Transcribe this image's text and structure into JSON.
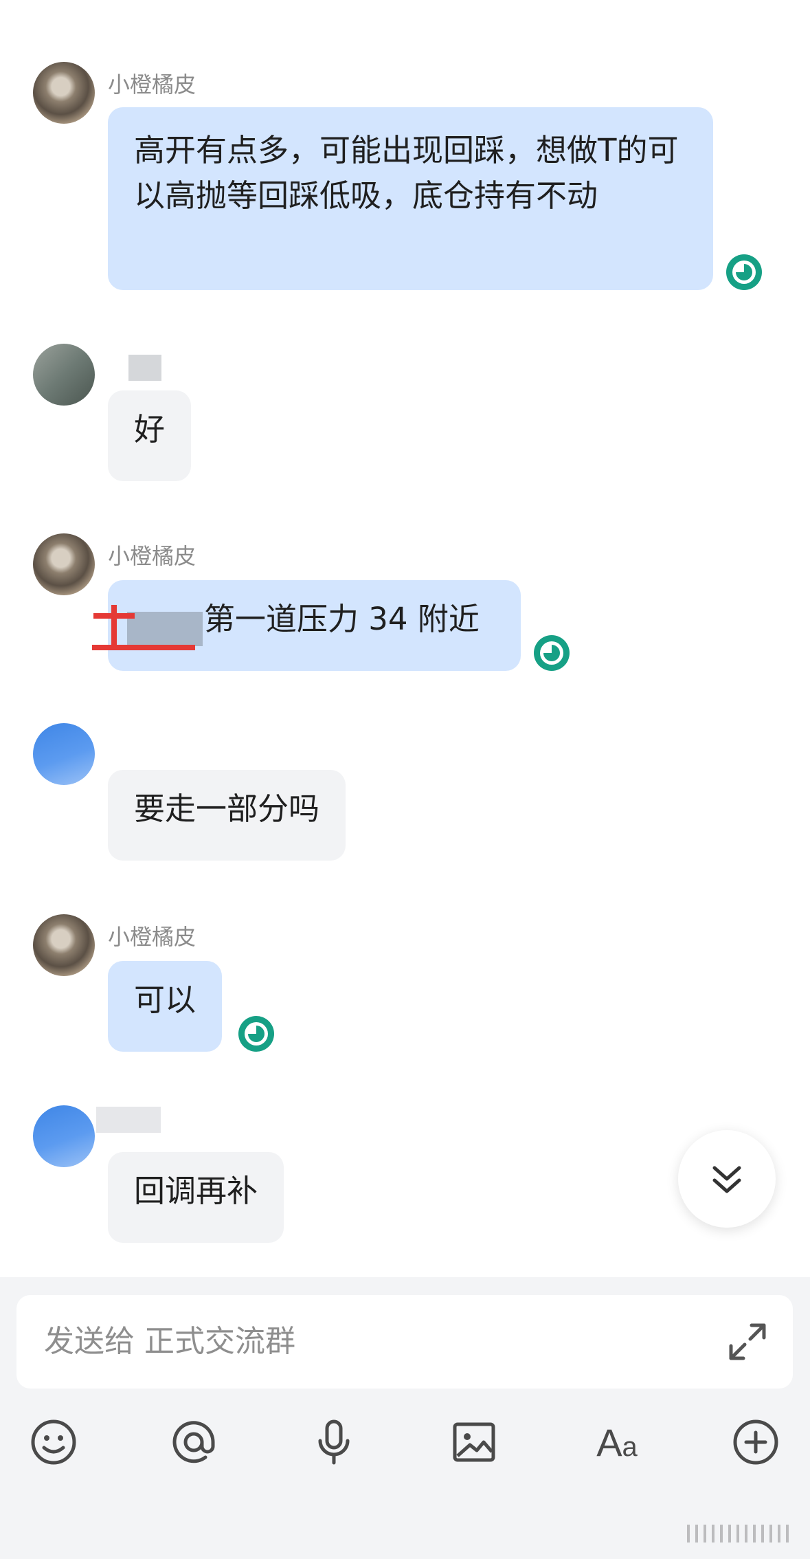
{
  "messages": [
    {
      "sender": "小橙橘皮",
      "text": "高开有点多，可能出现回踩，想做T的可以高抛等回踩低吸，底仓持有不动",
      "mine": true
    },
    {
      "sender": "",
      "text": "好",
      "mine": false
    },
    {
      "sender": "小橙橘皮",
      "text": "第一道压力 34 附近",
      "mine": true
    },
    {
      "sender": "",
      "text": "要走一部分吗",
      "mine": false
    },
    {
      "sender": "小橙橘皮",
      "text": "可以",
      "mine": true
    },
    {
      "sender": "",
      "text": "回调再补",
      "mine": false
    }
  ],
  "composer": {
    "placeholder": "发送给 正式交流群"
  },
  "toolbar": {
    "font_label_big": "A",
    "font_label_small": "a"
  },
  "colors": {
    "mine_bubble": "#d3e5fe",
    "other_bubble": "#f2f3f5",
    "read_icon": "#16a085"
  },
  "icons": [
    "emoji-icon",
    "at-icon",
    "microphone-icon",
    "image-icon",
    "font-icon",
    "plus-icon",
    "expand-icon",
    "scroll-down-icon",
    "read-receipt-icon"
  ]
}
